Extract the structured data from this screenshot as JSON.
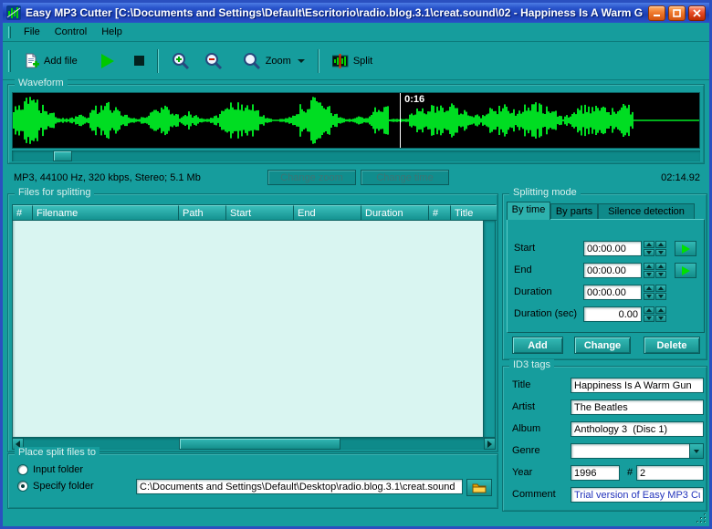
{
  "colors": {
    "background": "#169d9d",
    "waveform_green": "#00dd22",
    "titlebar_blue": "#2a52c8",
    "comment_text": "#2233bb"
  },
  "window": {
    "title": "Easy MP3 Cutter [C:\\Documents and Settings\\Default\\Escritorio\\radio.blog.3.1\\creat.sound\\02 - Happiness Is A Warm G"
  },
  "menu": {
    "items": [
      "File",
      "Control",
      "Help"
    ]
  },
  "toolbar": {
    "add_file": "Add file",
    "zoom_label": "Zoom",
    "split": "Split"
  },
  "waveform": {
    "label": "Waveform",
    "cursor_time": "0:16"
  },
  "info_bar": {
    "format": "MP3, 44100 Hz, 320 kbps, Stereo; 5.1 Mb",
    "change_zoom": "Change zoom",
    "change_time": "Change time",
    "total_time": "02:14.92"
  },
  "files_table": {
    "label": "Files for splitting",
    "columns": [
      "#",
      "Filename",
      "Path",
      "Start",
      "End",
      "Duration",
      "#",
      "Title"
    ],
    "rows": []
  },
  "splitting": {
    "label": "Splitting mode",
    "tabs": [
      "By time",
      "By parts",
      "Silence detection"
    ],
    "active_tab": "By time",
    "start_label": "Start",
    "start_value": "00:00.00",
    "end_label": "End",
    "end_value": "00:00.00",
    "duration_label": "Duration",
    "duration_value": "00:00.00",
    "duration_sec_label": "Duration (sec)",
    "duration_sec_value": "0.00",
    "add": "Add",
    "change": "Change",
    "delete": "Delete"
  },
  "id3": {
    "label": "ID3 tags",
    "title_label": "Title",
    "title_value": "Happiness Is A Warm Gun",
    "artist_label": "Artist",
    "artist_value": "The Beatles",
    "album_label": "Album",
    "album_value": "Anthology 3  (Disc 1)",
    "genre_label": "Genre",
    "genre_value": "",
    "year_label": "Year",
    "year_value": "1996",
    "track_label": "#",
    "track_value": "2",
    "comment_label": "Comment",
    "comment_value": "Trial version of Easy MP3 Cu"
  },
  "place": {
    "label": "Place split files to",
    "input_folder": "Input folder",
    "specify_folder": "Specify folder",
    "selected": "Specify folder",
    "path": "C:\\Documents and Settings\\Default\\Desktop\\radio.blog.3.1\\creat.sound"
  }
}
